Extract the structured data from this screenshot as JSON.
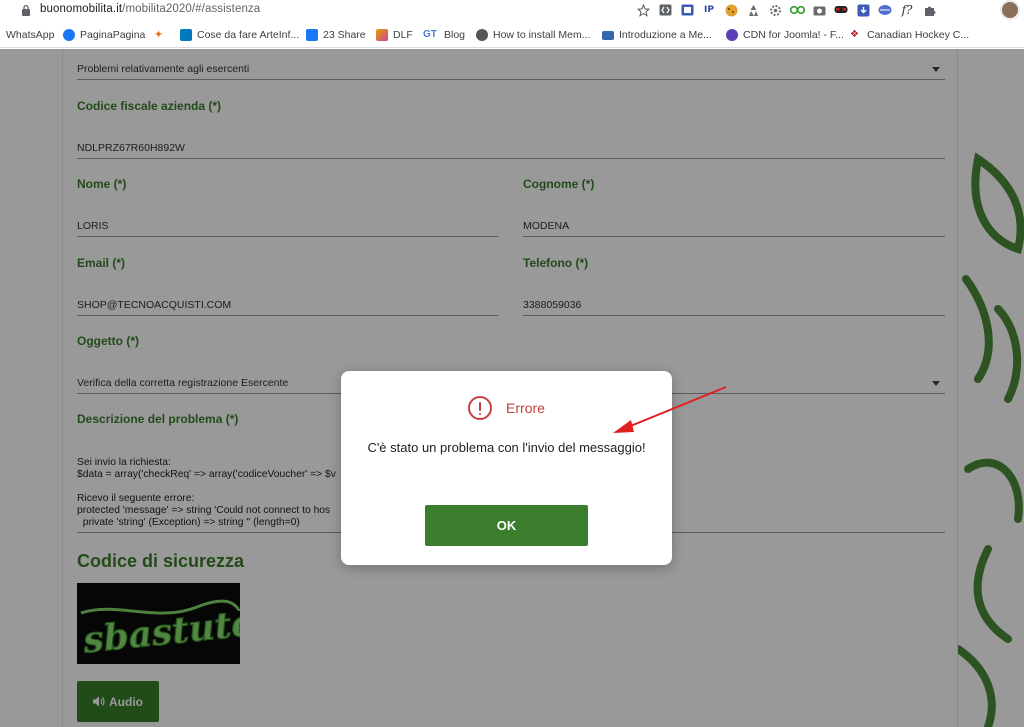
{
  "browser": {
    "url_host": "buonomobilita.it",
    "url_path": "/mobilita2020/#/assistenza",
    "extension_icons": [
      "star-icon",
      "code-icon",
      "reader-icon",
      "ip-icon",
      "cookie-icon",
      "recycle-icon",
      "gear-icon",
      "tripadvisor-icon",
      "camera-icon",
      "mask-icon",
      "download-icon",
      "globe-icon",
      "font-icon",
      "puzzle-icon"
    ],
    "ext_ip_label": "IP",
    "ext_font_label": "f?",
    "bookmarks": [
      {
        "label": "WhatsApp",
        "icon": "whatsapp-icon",
        "color": "#25d366"
      },
      {
        "label": "PaginaPagina",
        "icon": "facebook-icon",
        "color": "#1877f2"
      },
      {
        "label": "",
        "icon": "spark-icon",
        "color": "#e8711a"
      },
      {
        "label": "Cose da fare ArteInf...",
        "icon": "trello-icon",
        "color": "#0079bf"
      },
      {
        "label": "23 Share",
        "icon": "facebook-icon",
        "color": "#1877f2"
      },
      {
        "label": "DLF",
        "icon": "brush-icon",
        "color": "#e0a400"
      },
      {
        "label": "Blog",
        "icon": "gt-icon",
        "color": "#4a7ad0"
      },
      {
        "label": "How to install Mem...",
        "icon": "globe-icon",
        "color": "#555555"
      },
      {
        "label": "Introduzione a Me...",
        "icon": "monitor-icon",
        "color": "#3366aa"
      },
      {
        "label": "CDN for Joomla! - F...",
        "icon": "joomla-icon",
        "color": "#5b3fb8"
      },
      {
        "label": "Canadian Hockey C...",
        "icon": "logo-icon",
        "color": "#b22222"
      }
    ]
  },
  "form": {
    "problem_select": "Problemi relativamente agli esercenti",
    "tax_code_label": "Codice fiscale azienda (*)",
    "tax_code_value": "NDLPRZ67R60H892W",
    "nome_label": "Nome (*)",
    "nome_value": "LORIS",
    "cognome_label": "Cognome (*)",
    "cognome_value": "MODENA",
    "email_label": "Email (*)",
    "email_value": "SHOP@TECNOACQUISTI.COM",
    "telefono_label": "Telefono (*)",
    "telefono_value": "3388059036",
    "oggetto_label": "Oggetto (*)",
    "oggetto_select": "Verifica della corretta registrazione Esercente",
    "descrizione_label": "Descrizione del problema (*)",
    "descrizione_lines": [
      "Sei invio la richiesta:",
      "$data = array('checkReq' => array('codiceVoucher' => $v",
      "",
      "Ricevo il seguente errore:",
      "protected 'message' => string 'Could not connect to hos",
      "  private 'string' (Exception) => string '' (length=0)"
    ],
    "security_title": "Codice di sicurezza",
    "captcha_text": "sbastute",
    "audio_label": "Audio"
  },
  "modal": {
    "title": "Errore",
    "message": "C'è stato un problema con l'invio del messaggio!",
    "ok_label": "OK"
  },
  "colors": {
    "brand_green": "#3a7d2c",
    "error_red": "#c2413b",
    "annotation_arrow": "#e02020"
  }
}
